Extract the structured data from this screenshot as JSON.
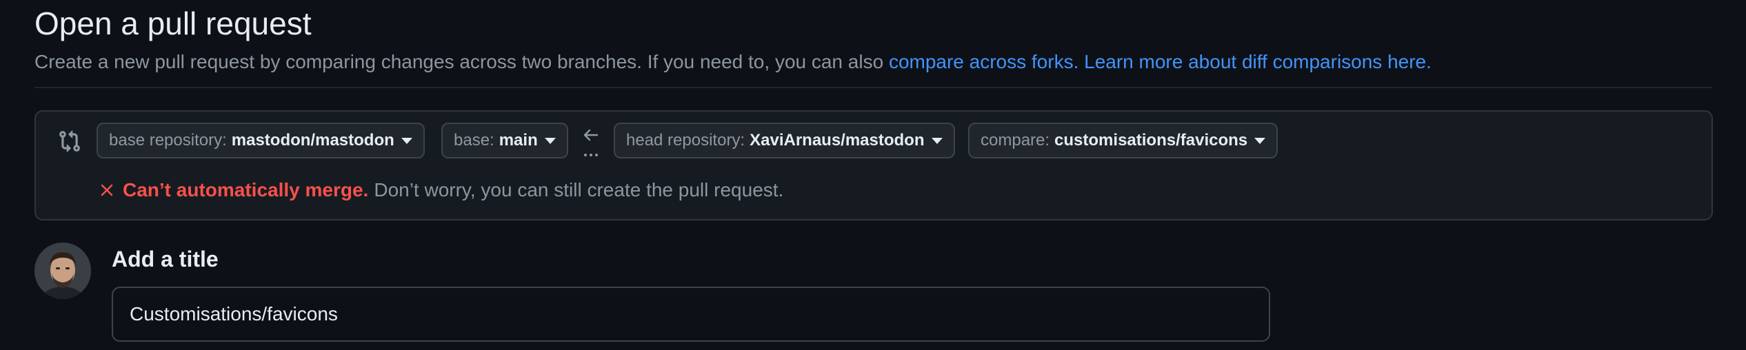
{
  "header": {
    "title": "Open a pull request",
    "subtitle_text": "Create a new pull request by comparing changes across two branches. If you need to, you can also ",
    "compare_forks_link": "compare across forks.",
    "learn_more_link": "Learn more about diff comparisons here."
  },
  "compare": {
    "base_repo": {
      "label": "base repository:",
      "value": "mastodon/mastodon"
    },
    "base": {
      "label": "base:",
      "value": "main"
    },
    "head_repo": {
      "label": "head repository:",
      "value": "XaviArnaus/mastodon"
    },
    "compare_branch": {
      "label": "compare:",
      "value": "customisations/favicons"
    },
    "merge_status": {
      "error": "Can’t automatically merge.",
      "message": "Don’t worry, you can still create the pull request."
    }
  },
  "form": {
    "title_label": "Add a title",
    "title_value": "Customisations/favicons"
  },
  "colors": {
    "background": "#0d1117",
    "panel": "#161b22",
    "link": "#4493f8",
    "error": "#f85149"
  },
  "icons": [
    "git-compare-icon",
    "arrow-left-icon",
    "x-icon",
    "avatar"
  ]
}
